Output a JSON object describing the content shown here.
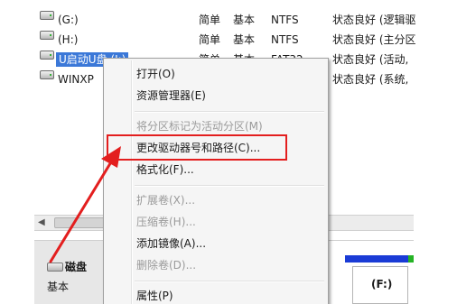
{
  "volumes": [
    {
      "name": "(G:)",
      "layout": "简单",
      "type": "基本",
      "fs": "NTFS",
      "status": "状态良好 (逻辑驱"
    },
    {
      "name": "(H:)",
      "layout": "简单",
      "type": "基本",
      "fs": "NTFS",
      "status": "状态良好 (主分区"
    },
    {
      "name": "U启动U盘 (I:)",
      "layout": "简单",
      "type": "基本",
      "fs": "FAT32",
      "status": "状态良好 (活动,"
    },
    {
      "name": "WINXP",
      "layout": "",
      "type": "",
      "fs": "",
      "status": "状态良好 (系统,"
    }
  ],
  "context_menu": {
    "items": [
      {
        "label": "打开(O)",
        "enabled": true
      },
      {
        "label": "资源管理器(E)",
        "enabled": true
      },
      {
        "label": "将分区标记为活动分区(M)",
        "enabled": false
      },
      {
        "label": "更改驱动器号和路径(C)...",
        "enabled": true,
        "highlighted": true
      },
      {
        "label": "格式化(F)...",
        "enabled": true
      },
      {
        "label": "扩展卷(X)...",
        "enabled": false
      },
      {
        "label": "压缩卷(H)...",
        "enabled": false
      },
      {
        "label": "添加镜像(A)...",
        "enabled": true
      },
      {
        "label": "删除卷(D)...",
        "enabled": false
      },
      {
        "label": "属性(P)",
        "enabled": true
      }
    ]
  },
  "disk_map": {
    "disk_label": "磁盘",
    "disk_type": "基本",
    "partition_letter": "(F:)"
  },
  "colors": {
    "annotation": "#e31e1e",
    "selection": "#3b78d8",
    "partition_primary": "#1a3bd6",
    "partition_free": "#25b325"
  },
  "icons": {
    "drive": "drive-icon",
    "disk": "disk-icon",
    "scroll_left": "scroll-left-arrow-icon",
    "annotation": "red-arrow-icon"
  }
}
